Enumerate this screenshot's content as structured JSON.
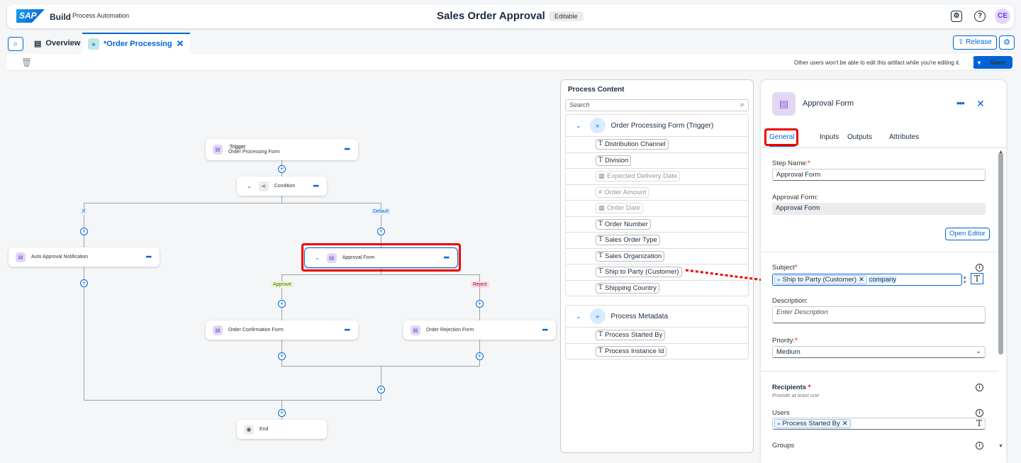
{
  "header": {
    "logo": "SAP",
    "brand": "Build",
    "brand_sub": "Process Automation",
    "title": "Sales Order Approval",
    "badge": "Editable",
    "avatar": "CE"
  },
  "tabs": {
    "overview": "Overview",
    "active": "*Order Processing",
    "release": "Release"
  },
  "toolbar": {
    "note": "Other users won't be able to edit this artifact while you're editing it.",
    "save": "Save"
  },
  "canvas": {
    "trigger_tag": "Trigger",
    "trigger_name": "Order Processing Form",
    "condition": "Condition",
    "if": "If",
    "default": "Default",
    "auto": "Auto Approval Notification",
    "approval": "Approval Form",
    "approve": "Approve",
    "reject": "Reject",
    "confirm": "Order Confirmation Form",
    "rejection": "Order Rejection Form",
    "end": "End"
  },
  "process_content": {
    "title": "Process Content",
    "search": "Search",
    "group1": "Order Processing Form (Trigger)",
    "items1": [
      "Distribution Channel",
      "Division",
      "Expected Delivery Date",
      "Order Amount",
      "Order Date",
      "Order Number",
      "Sales Order Type",
      "Sales Organization",
      "Ship to Party (Customer)",
      "Shipping Country"
    ],
    "group2": "Process Metadata",
    "items2": [
      "Process Started By",
      "Process Instance Id"
    ]
  },
  "panel": {
    "title": "Approval Form",
    "tabs": [
      "General",
      "Inputs",
      "Outputs",
      "Attributes"
    ],
    "step_label": "Step Name:",
    "step_value": "Approval Form",
    "form_label": "Approval Form:",
    "form_value": "Approval Form",
    "open_editor": "Open Editor",
    "subject_label": "Subject",
    "subject_token": "Ship to Party (Customer)",
    "subject_text": "company",
    "desc_label": "Description:",
    "desc_placeholder": "Enter Description",
    "priority_label": "Priority:",
    "priority_value": "Medium",
    "recipients": "Recipients",
    "recipients_hint": "Provide at least one",
    "users_label": "Users",
    "users_token": "Process Started By",
    "groups_label": "Groups"
  }
}
